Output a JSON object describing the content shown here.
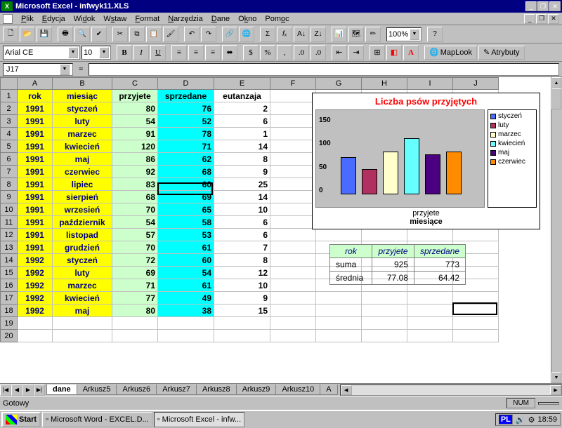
{
  "titlebar": {
    "title": "Microsoft Excel - infwyk11.XLS"
  },
  "menu": [
    "Plik",
    "Edycja",
    "Widok",
    "Wstaw",
    "Format",
    "Narzędzia",
    "Dane",
    "Okno",
    "Pomoc"
  ],
  "menu_underline_idx": [
    0,
    0,
    2,
    1,
    0,
    0,
    0,
    1,
    3
  ],
  "zoom": "100%",
  "font": "Arial CE",
  "fontsize": "10",
  "ext_buttons": {
    "maplook": "MapLook",
    "atrybuty": "Atrybuty"
  },
  "namebox": "J17",
  "columns": [
    "A",
    "B",
    "C",
    "D",
    "E",
    "F",
    "G",
    "H",
    "I",
    "J"
  ],
  "headers": {
    "A": "rok",
    "B": "miesiąc",
    "C": "przyjete",
    "D": "sprzedane",
    "E": "eutanzaja"
  },
  "rows": [
    {
      "r": 2,
      "A": "1991",
      "B": "styczeń",
      "C": "80",
      "D": "76",
      "E": "2"
    },
    {
      "r": 3,
      "A": "1991",
      "B": "luty",
      "C": "54",
      "D": "52",
      "E": "6"
    },
    {
      "r": 4,
      "A": "1991",
      "B": "marzec",
      "C": "91",
      "D": "78",
      "E": "1"
    },
    {
      "r": 5,
      "A": "1991",
      "B": "kwiecień",
      "C": "120",
      "D": "71",
      "E": "14"
    },
    {
      "r": 6,
      "A": "1991",
      "B": "maj",
      "C": "86",
      "D": "62",
      "E": "8"
    },
    {
      "r": 7,
      "A": "1991",
      "B": "czerwiec",
      "C": "92",
      "D": "68",
      "E": "9"
    },
    {
      "r": 8,
      "A": "1991",
      "B": "lipiec",
      "C": "83",
      "D": "60",
      "E": "25"
    },
    {
      "r": 9,
      "A": "1991",
      "B": "sierpień",
      "C": "68",
      "D": "69",
      "E": "14"
    },
    {
      "r": 10,
      "A": "1991",
      "B": "wrzesień",
      "C": "70",
      "D": "65",
      "E": "10"
    },
    {
      "r": 11,
      "A": "1991",
      "B": "październik",
      "C": "54",
      "D": "58",
      "E": "6"
    },
    {
      "r": 12,
      "A": "1991",
      "B": "listopad",
      "C": "57",
      "D": "53",
      "E": "6"
    },
    {
      "r": 13,
      "A": "1991",
      "B": "grudzień",
      "C": "70",
      "D": "61",
      "E": "7"
    },
    {
      "r": 14,
      "A": "1992",
      "B": "styczeń",
      "C": "72",
      "D": "60",
      "E": "8"
    },
    {
      "r": 15,
      "A": "1992",
      "B": "luty",
      "C": "69",
      "D": "54",
      "E": "12"
    },
    {
      "r": 16,
      "A": "1992",
      "B": "marzec",
      "C": "71",
      "D": "61",
      "E": "10"
    },
    {
      "r": 17,
      "A": "1992",
      "B": "kwiecień",
      "C": "77",
      "D": "49",
      "E": "9"
    },
    {
      "r": 18,
      "A": "1992",
      "B": "maj",
      "C": "80",
      "D": "38",
      "E": "15"
    }
  ],
  "empty_rows": [
    19,
    20
  ],
  "sheet_tabs": [
    "dane",
    "Arkusz5",
    "Arkusz6",
    "Arkusz7",
    "Arkusz8",
    "Arkusz9",
    "Arkusz10",
    "A"
  ],
  "active_tab_index": 0,
  "status": {
    "ready": "Gotowy",
    "num": "NUM"
  },
  "taskbar": {
    "start": "Start",
    "tasks": [
      {
        "label": "Microsoft Word - EXCEL.D...",
        "active": false
      },
      {
        "label": "Microsoft Excel - infw...",
        "active": true
      }
    ],
    "tray_lang": "PL",
    "clock": "18:59"
  },
  "chart_data": {
    "type": "bar",
    "title": "Liczba psów przyjętych",
    "categories": [
      "styczeń",
      "luty",
      "marzec",
      "kwiecień",
      "maj",
      "czerwiec"
    ],
    "values": [
      80,
      54,
      91,
      120,
      86,
      92
    ],
    "xlabel_line1": "przyjete",
    "xlabel_line2": "miesiące",
    "ylim": [
      0,
      150
    ],
    "yticks": [
      0,
      50,
      100,
      150
    ],
    "colors": [
      "#4a6bff",
      "#b03060",
      "#ffffcc",
      "#66ffff",
      "#4b0082",
      "#ff8c00"
    ]
  },
  "summary": {
    "headers": [
      "rok",
      "przyjete",
      "sprzedane"
    ],
    "rows": [
      {
        "label": "suma",
        "przyjete": "925",
        "sprzedane": "773"
      },
      {
        "label": "średnia",
        "przyjete": "77.08",
        "sprzedane": "64.42"
      }
    ]
  },
  "active_cell": {
    "row": 8,
    "col": "D"
  },
  "secondary_cursor": {
    "row": 17,
    "col": "J"
  }
}
